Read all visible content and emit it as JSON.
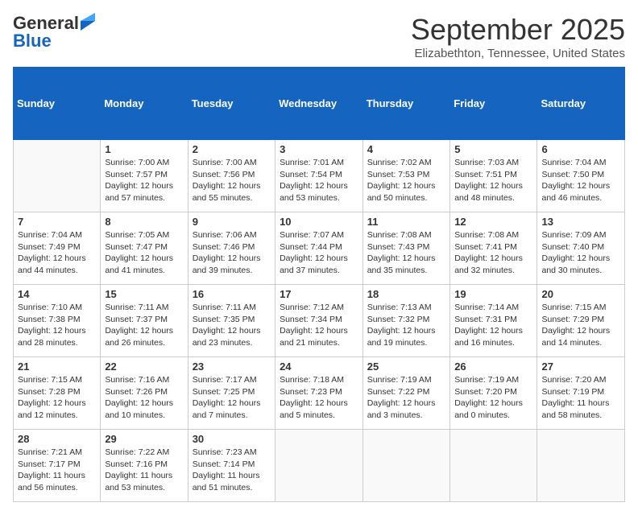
{
  "logo": {
    "general": "General",
    "blue": "Blue"
  },
  "title": "September 2025",
  "subtitle": "Elizabethton, Tennessee, United States",
  "weekdays": [
    "Sunday",
    "Monday",
    "Tuesday",
    "Wednesday",
    "Thursday",
    "Friday",
    "Saturday"
  ],
  "weeks": [
    [
      {
        "day": "",
        "info": ""
      },
      {
        "day": "1",
        "info": "Sunrise: 7:00 AM\nSunset: 7:57 PM\nDaylight: 12 hours\nand 57 minutes."
      },
      {
        "day": "2",
        "info": "Sunrise: 7:00 AM\nSunset: 7:56 PM\nDaylight: 12 hours\nand 55 minutes."
      },
      {
        "day": "3",
        "info": "Sunrise: 7:01 AM\nSunset: 7:54 PM\nDaylight: 12 hours\nand 53 minutes."
      },
      {
        "day": "4",
        "info": "Sunrise: 7:02 AM\nSunset: 7:53 PM\nDaylight: 12 hours\nand 50 minutes."
      },
      {
        "day": "5",
        "info": "Sunrise: 7:03 AM\nSunset: 7:51 PM\nDaylight: 12 hours\nand 48 minutes."
      },
      {
        "day": "6",
        "info": "Sunrise: 7:04 AM\nSunset: 7:50 PM\nDaylight: 12 hours\nand 46 minutes."
      }
    ],
    [
      {
        "day": "7",
        "info": "Sunrise: 7:04 AM\nSunset: 7:49 PM\nDaylight: 12 hours\nand 44 minutes."
      },
      {
        "day": "8",
        "info": "Sunrise: 7:05 AM\nSunset: 7:47 PM\nDaylight: 12 hours\nand 41 minutes."
      },
      {
        "day": "9",
        "info": "Sunrise: 7:06 AM\nSunset: 7:46 PM\nDaylight: 12 hours\nand 39 minutes."
      },
      {
        "day": "10",
        "info": "Sunrise: 7:07 AM\nSunset: 7:44 PM\nDaylight: 12 hours\nand 37 minutes."
      },
      {
        "day": "11",
        "info": "Sunrise: 7:08 AM\nSunset: 7:43 PM\nDaylight: 12 hours\nand 35 minutes."
      },
      {
        "day": "12",
        "info": "Sunrise: 7:08 AM\nSunset: 7:41 PM\nDaylight: 12 hours\nand 32 minutes."
      },
      {
        "day": "13",
        "info": "Sunrise: 7:09 AM\nSunset: 7:40 PM\nDaylight: 12 hours\nand 30 minutes."
      }
    ],
    [
      {
        "day": "14",
        "info": "Sunrise: 7:10 AM\nSunset: 7:38 PM\nDaylight: 12 hours\nand 28 minutes."
      },
      {
        "day": "15",
        "info": "Sunrise: 7:11 AM\nSunset: 7:37 PM\nDaylight: 12 hours\nand 26 minutes."
      },
      {
        "day": "16",
        "info": "Sunrise: 7:11 AM\nSunset: 7:35 PM\nDaylight: 12 hours\nand 23 minutes."
      },
      {
        "day": "17",
        "info": "Sunrise: 7:12 AM\nSunset: 7:34 PM\nDaylight: 12 hours\nand 21 minutes."
      },
      {
        "day": "18",
        "info": "Sunrise: 7:13 AM\nSunset: 7:32 PM\nDaylight: 12 hours\nand 19 minutes."
      },
      {
        "day": "19",
        "info": "Sunrise: 7:14 AM\nSunset: 7:31 PM\nDaylight: 12 hours\nand 16 minutes."
      },
      {
        "day": "20",
        "info": "Sunrise: 7:15 AM\nSunset: 7:29 PM\nDaylight: 12 hours\nand 14 minutes."
      }
    ],
    [
      {
        "day": "21",
        "info": "Sunrise: 7:15 AM\nSunset: 7:28 PM\nDaylight: 12 hours\nand 12 minutes."
      },
      {
        "day": "22",
        "info": "Sunrise: 7:16 AM\nSunset: 7:26 PM\nDaylight: 12 hours\nand 10 minutes."
      },
      {
        "day": "23",
        "info": "Sunrise: 7:17 AM\nSunset: 7:25 PM\nDaylight: 12 hours\nand 7 minutes."
      },
      {
        "day": "24",
        "info": "Sunrise: 7:18 AM\nSunset: 7:23 PM\nDaylight: 12 hours\nand 5 minutes."
      },
      {
        "day": "25",
        "info": "Sunrise: 7:19 AM\nSunset: 7:22 PM\nDaylight: 12 hours\nand 3 minutes."
      },
      {
        "day": "26",
        "info": "Sunrise: 7:19 AM\nSunset: 7:20 PM\nDaylight: 12 hours\nand 0 minutes."
      },
      {
        "day": "27",
        "info": "Sunrise: 7:20 AM\nSunset: 7:19 PM\nDaylight: 11 hours\nand 58 minutes."
      }
    ],
    [
      {
        "day": "28",
        "info": "Sunrise: 7:21 AM\nSunset: 7:17 PM\nDaylight: 11 hours\nand 56 minutes."
      },
      {
        "day": "29",
        "info": "Sunrise: 7:22 AM\nSunset: 7:16 PM\nDaylight: 11 hours\nand 53 minutes."
      },
      {
        "day": "30",
        "info": "Sunrise: 7:23 AM\nSunset: 7:14 PM\nDaylight: 11 hours\nand 51 minutes."
      },
      {
        "day": "",
        "info": ""
      },
      {
        "day": "",
        "info": ""
      },
      {
        "day": "",
        "info": ""
      },
      {
        "day": "",
        "info": ""
      }
    ]
  ]
}
